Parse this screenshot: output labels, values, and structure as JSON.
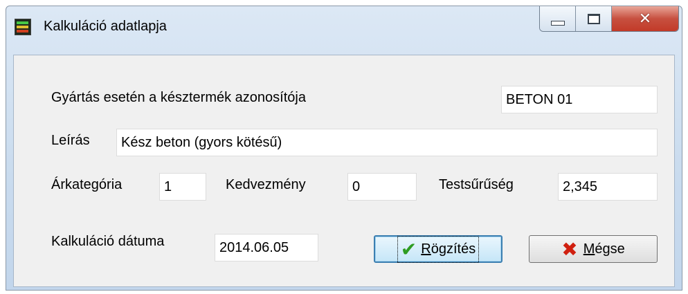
{
  "window": {
    "title": "Kalkuláció adatlapja",
    "controls": {
      "minimize": "minimize",
      "maximize": "maximize",
      "close": "x"
    }
  },
  "form": {
    "product_id_label": "Gyártás esetén a késztermék azonosítója",
    "product_id_value": "BETON 01",
    "description_label": "Leírás",
    "description_value": "Kész beton (gyors kötésű)",
    "price_category_label": "Árkategória",
    "price_category_value": "1",
    "discount_label": "Kedvezmény",
    "discount_value": "0",
    "density_label": "Testsűrűség",
    "density_value": "2,345",
    "date_label": "Kalkuláció dátuma",
    "date_value": "2014.06.05"
  },
  "buttons": {
    "save_mnemonic": "R",
    "save_rest": "ögzítés",
    "cancel_mnemonic": "M",
    "cancel_rest": "égse"
  },
  "icons": {
    "app": "app-icon",
    "save": "checkmark-icon",
    "cancel": "x-mark-icon"
  }
}
